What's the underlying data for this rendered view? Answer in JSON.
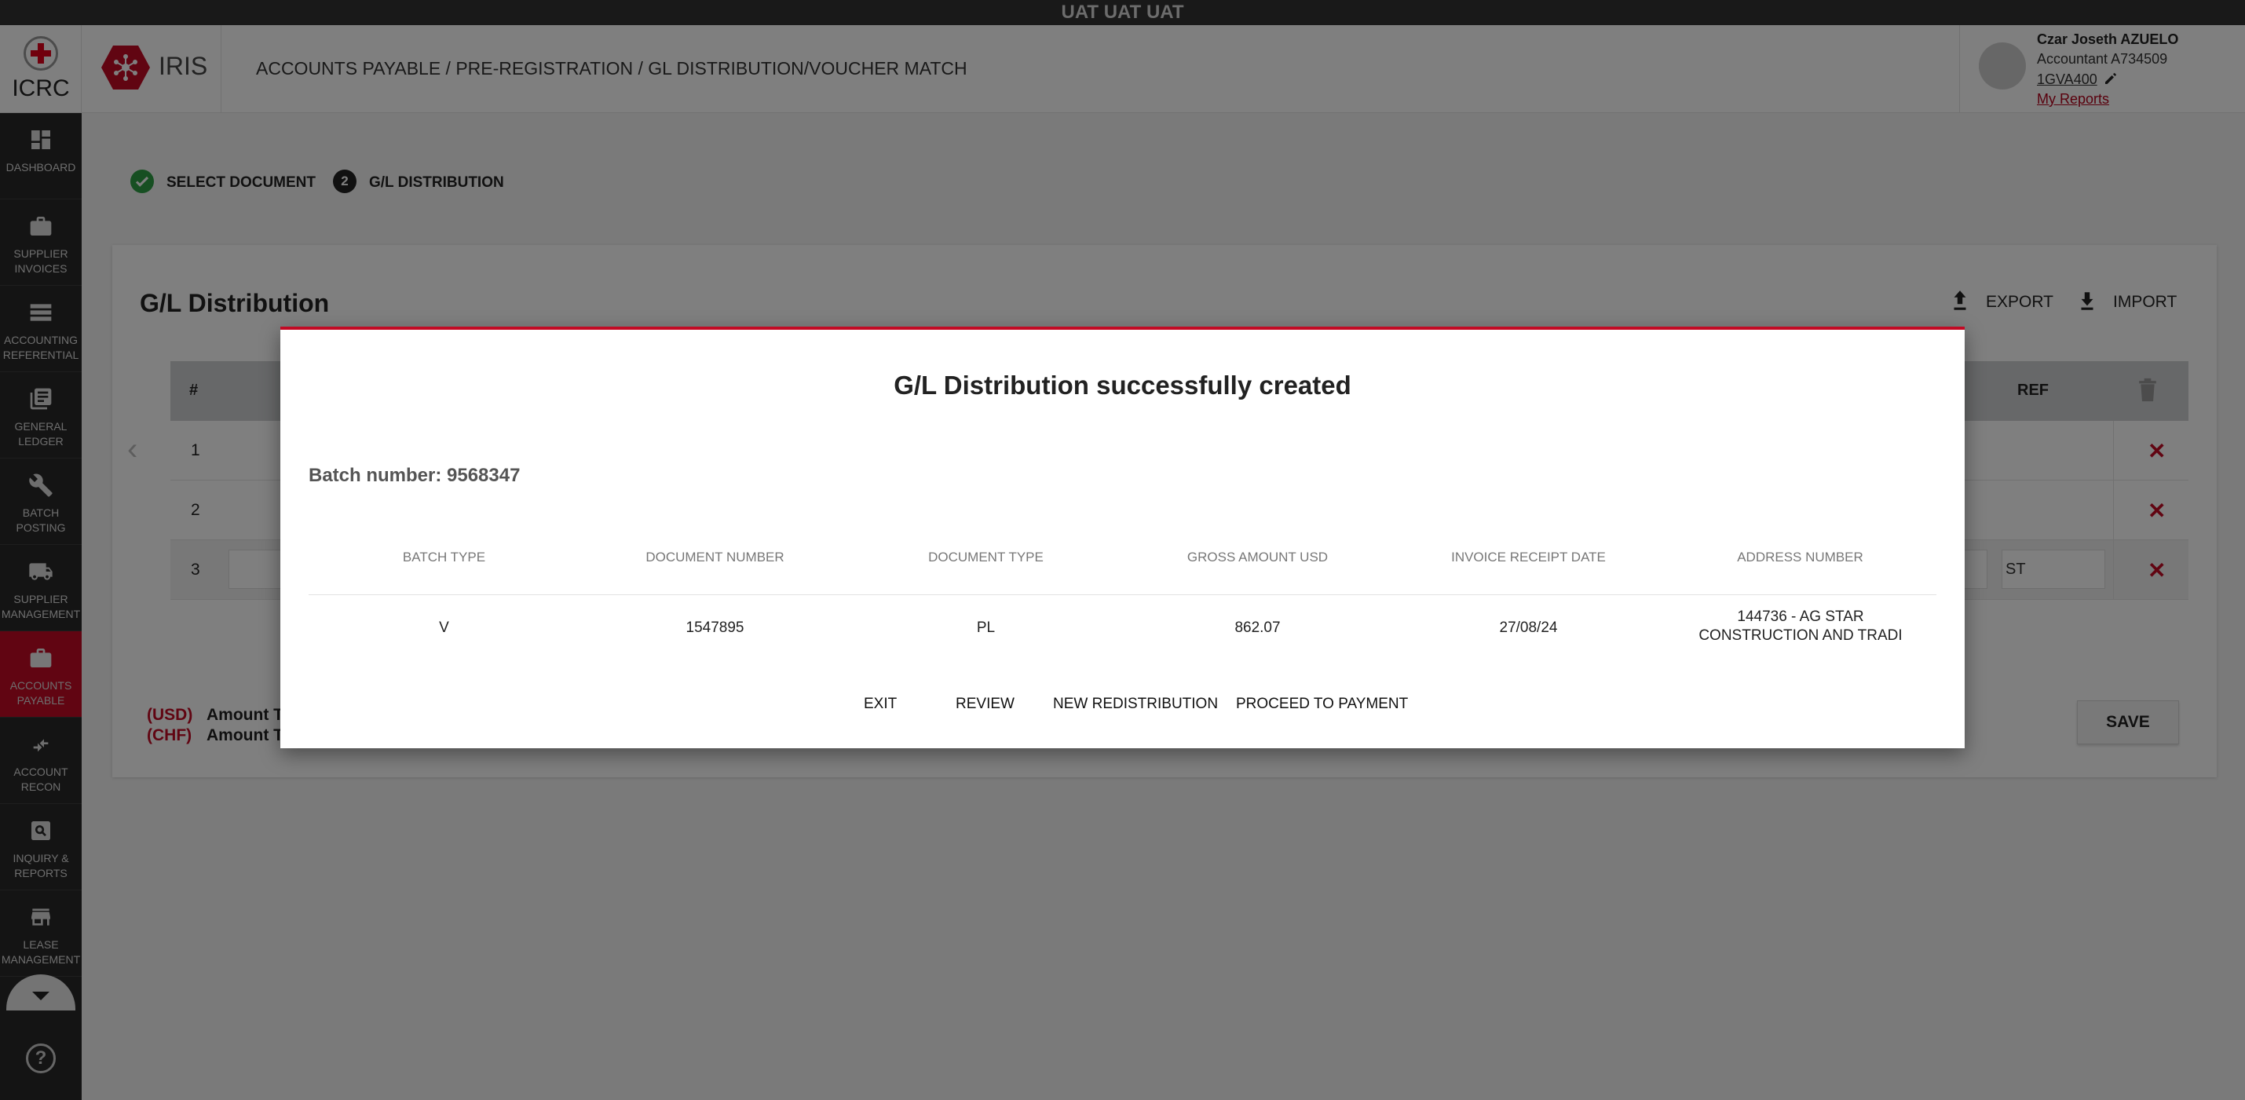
{
  "env_banner": "UAT UAT UAT",
  "header": {
    "org_name": "ICRC",
    "app_name": "IRIS",
    "breadcrumb": "ACCOUNTS PAYABLE / PRE-REGISTRATION / GL DISTRIBUTION/VOUCHER MATCH",
    "user": {
      "name": "Czar Joseth AZUELO",
      "role": "Accountant A734509",
      "code": "1GVA400",
      "reports_link": "My Reports"
    }
  },
  "sidebar": {
    "items": [
      {
        "label": "DASHBOARD",
        "icon": "dashboard-icon"
      },
      {
        "label": "SUPPLIER INVOICES",
        "icon": "briefcase-icon"
      },
      {
        "label": "ACCOUNTING REFERENTIAL",
        "icon": "storage-icon"
      },
      {
        "label": "GENERAL LEDGER",
        "icon": "ledger-icon"
      },
      {
        "label": "BATCH POSTING",
        "icon": "wrench-icon"
      },
      {
        "label": "SUPPLIER MANAGEMENT",
        "icon": "truck-icon"
      },
      {
        "label": "ACCOUNTS PAYABLE",
        "icon": "briefcase-icon",
        "active": true
      },
      {
        "label": "ACCOUNT RECON",
        "icon": "arrows-icon"
      },
      {
        "label": "INQUIRY & REPORTS",
        "icon": "search-icon"
      },
      {
        "label": "LEASE MANAGEMENT",
        "icon": "store-icon"
      }
    ],
    "help": "?"
  },
  "stepper": {
    "step1": "SELECT DOCUMENT",
    "step2_num": "2",
    "step2": "G/L DISTRIBUTION"
  },
  "card": {
    "title": "G/L Distribution",
    "export_label": "EXPORT",
    "import_label": "IMPORT",
    "table": {
      "col_hash": "#",
      "col_ref_partial": "REF",
      "rows": [
        {
          "num": "1"
        },
        {
          "num": "2"
        },
        {
          "num": "3",
          "end_input": "ST"
        }
      ]
    },
    "totals": {
      "usd_currency": "(USD)",
      "usd_label": "Amount To",
      "chf_currency": "(CHF)",
      "chf_label": "Amount To"
    },
    "save_label": "SAVE"
  },
  "modal": {
    "title": "G/L Distribution successfully created",
    "batch_number": "Batch number: 9568347",
    "columns": [
      "BATCH TYPE",
      "DOCUMENT NUMBER",
      "DOCUMENT TYPE",
      "GROSS AMOUNT USD",
      "INVOICE RECEIPT DATE",
      "ADDRESS NUMBER"
    ],
    "row": [
      "V",
      "1547895",
      "PL",
      "862.07",
      "27/08/24",
      "144736 - AG STAR CONSTRUCTION AND TRADI"
    ],
    "actions": {
      "exit": "EXIT",
      "review": "REVIEW",
      "new_redistribution": "NEW REDISTRIBUTION",
      "proceed": "PROCEED TO PAYMENT"
    }
  },
  "colors": {
    "accent": "#c20a24",
    "sidebar_bg": "#292929",
    "success": "#2e9e44"
  }
}
